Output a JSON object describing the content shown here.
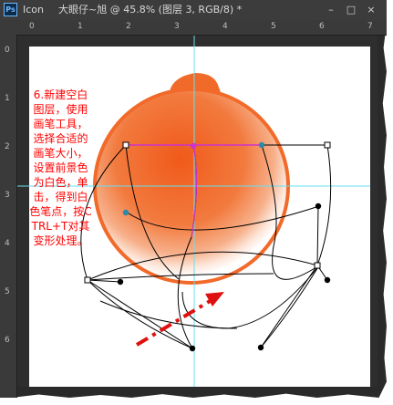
{
  "window": {
    "app_logo": "Ps",
    "app_name": "Icon",
    "document_title": "大眼仔~旭 @ 45.8% (图层 3, RGB/8) *",
    "controls": [
      "–",
      "□",
      "×"
    ]
  },
  "rulers": {
    "top_ticks": [
      "0",
      "1",
      "2",
      "3",
      "4",
      "5",
      "6",
      "7"
    ],
    "left_ticks": [
      "0",
      "1",
      "2",
      "3",
      "4",
      "5",
      "6"
    ]
  },
  "annotation": {
    "text": "6.新建空白图层，使用画笔工具，选择合适的画笔大小，设置前景色为白色，单击，得到白色笔点，按CTRL+T对其变形处理。"
  },
  "colors": {
    "accent_orange": "#f06a2a",
    "path_magenta": "#cc33cc",
    "guide_cyan": "#66e0f0",
    "arrow_red": "#e01010",
    "anchor_blue": "#2a8aaa"
  },
  "icons": {
    "app_logo": "photoshop-logo-icon"
  }
}
